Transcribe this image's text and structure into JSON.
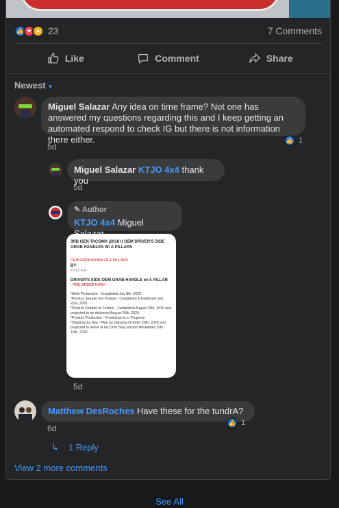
{
  "reactions": {
    "count": "23",
    "icons": [
      "like-icon",
      "love-icon",
      "wow-icon"
    ]
  },
  "comments_count": "7 Comments",
  "actions": {
    "like": "Like",
    "comment": "Comment",
    "share": "Share"
  },
  "sort": {
    "label": "Newest"
  },
  "comments": [
    {
      "author": "Miguel Salazar",
      "text": "Any idea on time frame? Not one has answered my questions regarding this and I keep getting an automated respond to check IG but there is not information there either.",
      "time": "5d",
      "reaction_count": "1"
    },
    {
      "author": "Miguel Salazar",
      "tag": "KTJO 4x4",
      "text": "thank you",
      "time": "5d"
    },
    {
      "badge": "Author",
      "author": "KTJO 4x4",
      "text": "Miguel Salazar",
      "time": "5d",
      "image": {
        "title": "3RD GEN TACOMA (2016+) OEM DRIVER'S SIDE GRAB HANDLES W/ A PILLARS",
        "red_heading": "OEM GRAB HANDLES & PILLARS",
        "by": "BY",
        "by_name": "KTJO 4x4",
        "sub_heading": "DRIVER'S SIDE OEM GRAB HANDLE w/ A PILLAR",
        "preorder": "- PRE-ORDER NOW!",
        "lines": [
          "*Mold Production - Completed July 8th, 2020.",
          "*Product Sample w/o Texture - Completed & Delivered July 21st, 2020.",
          "*Product Sample w/ Texture - Completed August 19th, 2020 and projected to be delivered August 26th, 2020.",
          "*Product Production - Production is in Progress",
          "*Shipping by Sea - Plan on shipping October 20th, 2020 and projected to arrive at my Door Step around November 12th - 16th, 2020."
        ]
      }
    },
    {
      "author": "Matthew DesRoches",
      "text": "Have these for the tundrA?",
      "time": "6d",
      "reaction_count": "1",
      "replies_link": "1 Reply"
    }
  ],
  "view_more": "View 2 more comments",
  "see_all": "See All"
}
